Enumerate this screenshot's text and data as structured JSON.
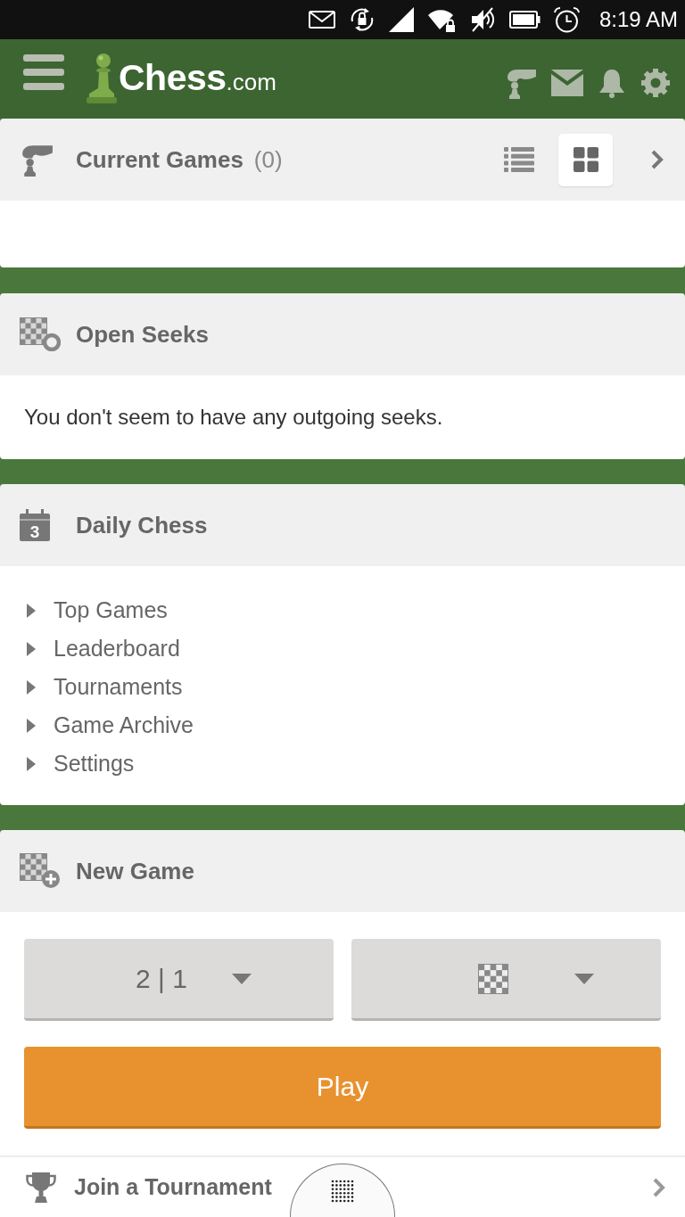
{
  "status_bar": {
    "time": "8:19 AM"
  },
  "app_bar": {
    "logo": {
      "name": "Chess",
      "suffix": ".com"
    }
  },
  "current_games": {
    "title": "Current Games",
    "count": "(0)",
    "view_modes": [
      {
        "kind": "list",
        "selected": false
      },
      {
        "kind": "grid",
        "selected": true
      }
    ]
  },
  "open_seeks": {
    "title": "Open Seeks",
    "message": "You don't seem to have any outgoing seeks."
  },
  "daily_chess": {
    "title": "Daily Chess",
    "icon_day": "3",
    "links": [
      "Top Games",
      "Leaderboard",
      "Tournaments",
      "Game Archive",
      "Settings"
    ]
  },
  "new_game": {
    "title": "New Game",
    "time_control": "2 | 1",
    "play_button": "Play"
  },
  "join_tournament": {
    "title": "Join a Tournament"
  }
}
